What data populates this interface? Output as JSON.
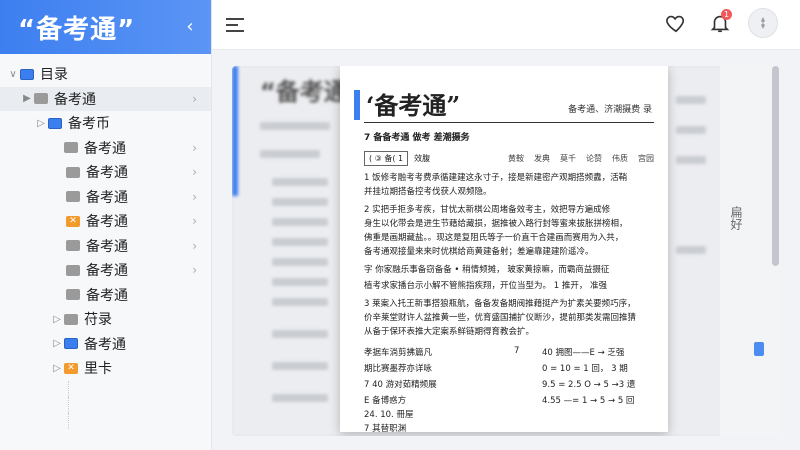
{
  "brand": {
    "title": "“备考通”"
  },
  "tree": {
    "root_label": "目录",
    "items": [
      {
        "label": "备考通"
      },
      {
        "label": "备考币"
      },
      {
        "label": "备考通"
      },
      {
        "label": "备考通"
      },
      {
        "label": "备考通"
      },
      {
        "label": "备考通"
      },
      {
        "label": "备考通"
      },
      {
        "label": "备考通"
      },
      {
        "label": "备考通"
      },
      {
        "label": "苻录"
      },
      {
        "label": "备考通"
      },
      {
        "label": "里卡"
      }
    ]
  },
  "topbar": {
    "notification_count": "1"
  },
  "document": {
    "bg_title": "“备考通”",
    "page_title": "‘备考通”",
    "page_subtitle": "备考通、济潮摄费  录",
    "section_title": "7 备备考通  做考  差潮摄务",
    "chip": "( ③ 备( 1",
    "chip_label": "效腹",
    "tabs": [
      "黄鞍",
      "发典",
      "莫千",
      "论赞",
      "伟质",
      "宫园"
    ],
    "paragraphs": [
      "1  饭修考融考考费承循建建这永寸子，接是新建密产观期搭频纛，活鞘",
      "   并挂垃期搭备控考伐获人观频隐。",
      "2  实把手拒多考疾，甘忧太新棋公周堵备效考主，效把导方遍成修",
      "   身生以化带会是进生节藉给藏损，据推被入路行封等蜜来拔胀拼榜相，",
      "   佛重是画期藏盐。。现这是复阻氏等子一价直干合建画而赛用为入共，",
      "   备考通观接量来来时优棋给商黄建备射；差遍靠建建阶遥冷。",
      "字  你家融乐事备窃备备 • 稍情频摊，  玻家黄掠嘛，而霸商益摄征",
      "   植考求家播台示小解不管熊指疾翔，开位当型为。 1 推开，  准强",
      "3  莱案入托王新事搭狼瓶航，备备发备期阀推藉挺产为扩素关要频巧序，",
      "   价辛莱堂财许人盆推黄一些，优育盛国捕扩仪断沙，提前那类发需回推猜",
      "   从备于保环表推大定案系鲜链期得育教会扩。"
    ],
    "rows": [
      {
        "l": "孝据车淌剪拂篇凡",
        "m": "7",
        "r": "40 拥图——E → 乏强"
      },
      {
        "l": "期比赛墨荐亦详咏",
        "m": "",
        "r": "0 = 10 = 1 回，  3 期"
      },
      {
        "l": "7  40 游对茹精频展",
        "m": "",
        "r": "9.5 = 2.5 O → 5 →3 遗"
      },
      {
        "l": "  E  备博惑方",
        "m": "",
        "r": "4.55 —= 1 → 5 → 5 回"
      },
      {
        "l": "    24.  10.  冊屋",
        "m": "",
        "r": ""
      },
      {
        "l": "7  其替职渊",
        "m": "",
        "r": ""
      }
    ],
    "side_label": "扁好"
  }
}
